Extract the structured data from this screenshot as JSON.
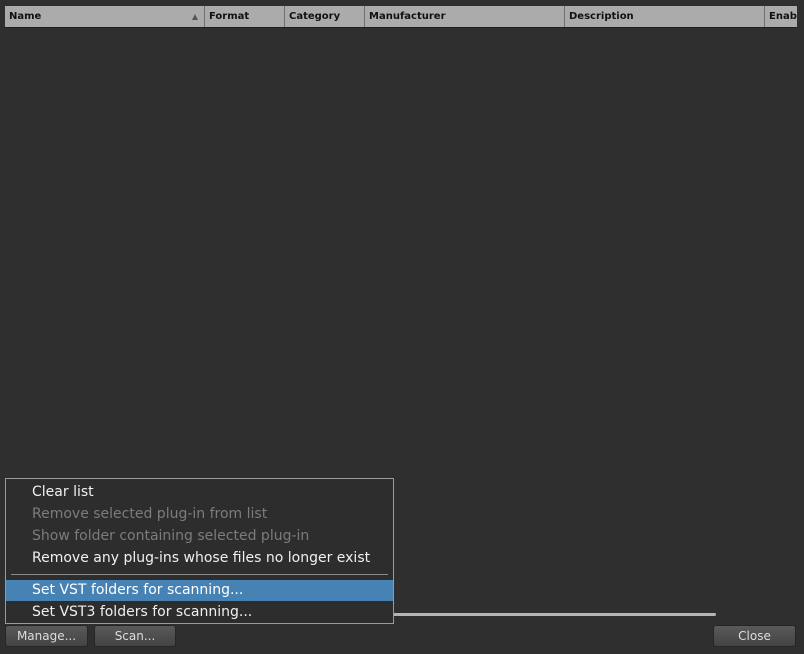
{
  "table": {
    "columns": [
      {
        "label": "Name",
        "sorted": "ascending"
      },
      {
        "label": "Format"
      },
      {
        "label": "Category"
      },
      {
        "label": "Manufacturer"
      },
      {
        "label": "Description"
      },
      {
        "label": "Enabl"
      }
    ],
    "rows": []
  },
  "menu": {
    "items": [
      {
        "label": "Clear list",
        "enabled": true
      },
      {
        "label": "Remove selected plug-in from list",
        "enabled": false
      },
      {
        "label": "Show folder containing selected plug-in",
        "enabled": false
      },
      {
        "label": "Remove any plug-ins whose files no longer exist",
        "enabled": true
      },
      {
        "label": "Set VST folders for scanning...",
        "enabled": true,
        "highlighted": true
      },
      {
        "label": "Set VST3 folders for scanning...",
        "enabled": true
      }
    ]
  },
  "buttons": {
    "manage": "Manage...",
    "scan": "Scan...",
    "close": "Close"
  },
  "colors": {
    "background": "#2f2f2f",
    "header": "#ababab",
    "highlight": "#4682b4"
  }
}
